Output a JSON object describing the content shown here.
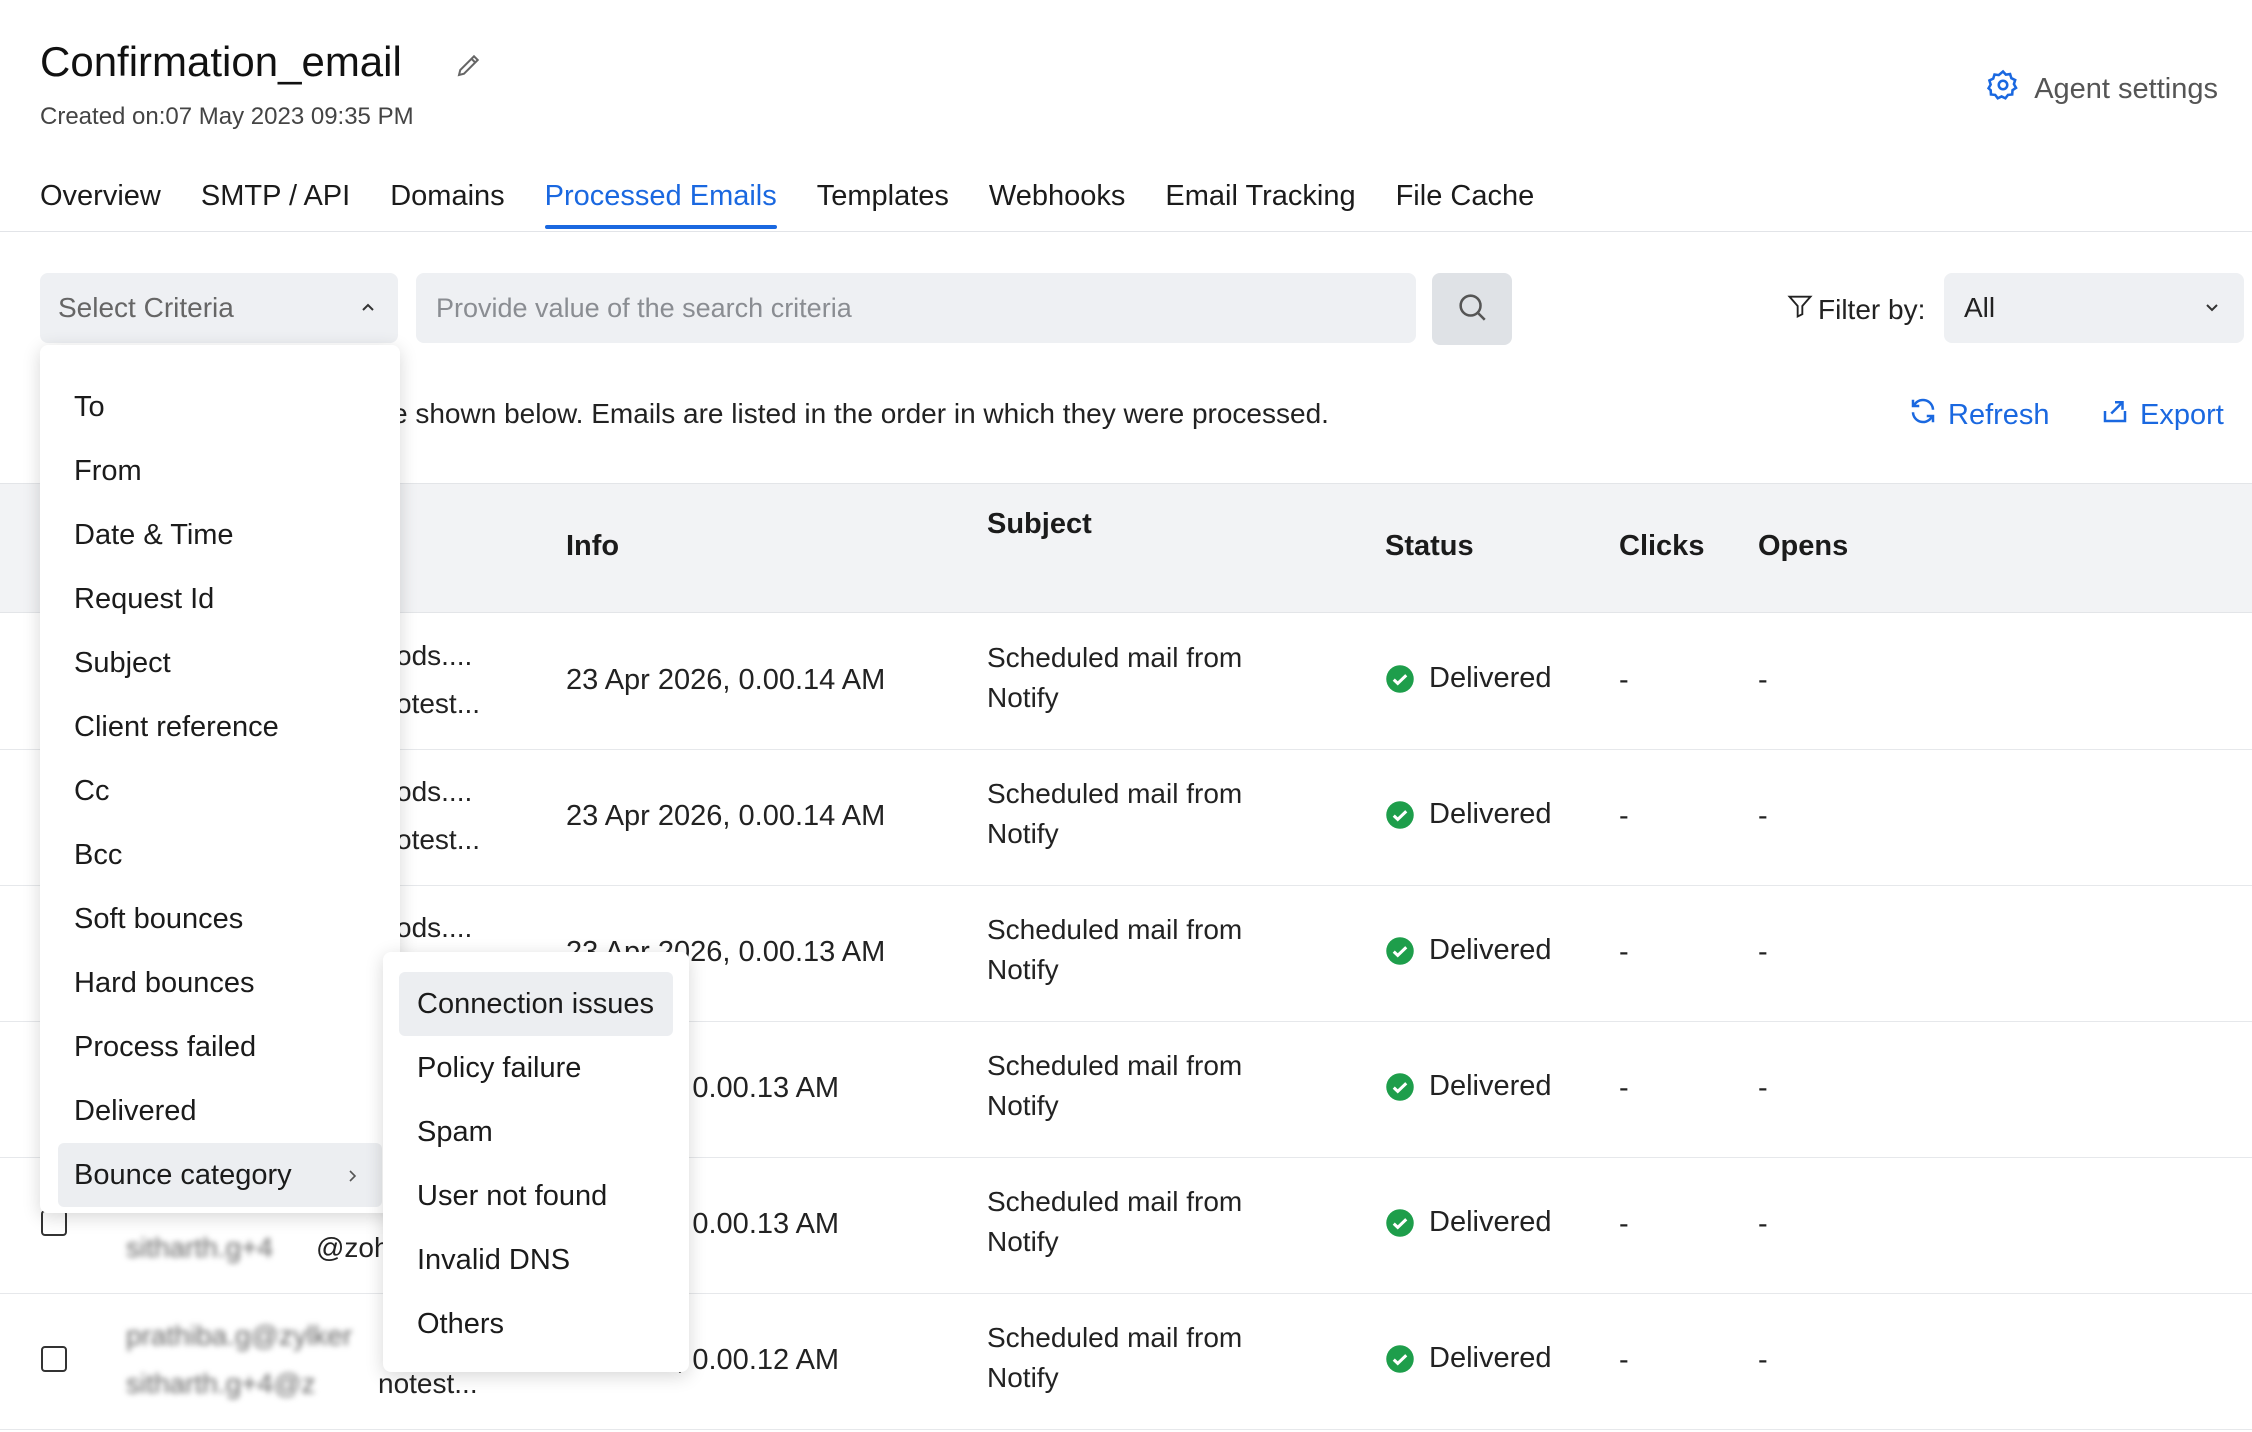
{
  "header": {
    "title": "Confirmation_email",
    "created": "Created on:07 May 2023 09:35 PM",
    "agent_settings": "Agent settings"
  },
  "tabs": [
    {
      "label": "Overview"
    },
    {
      "label": "SMTP / API"
    },
    {
      "label": "Domains"
    },
    {
      "label": "Processed Emails",
      "active": true
    },
    {
      "label": "Templates"
    },
    {
      "label": "Webhooks"
    },
    {
      "label": "Email Tracking"
    },
    {
      "label": "File Cache"
    }
  ],
  "search": {
    "criteria_label": "Select Criteria",
    "placeholder": "Provide value of the search criteria",
    "filter_label": "Filter by:",
    "filter_value": "All"
  },
  "info": {
    "text": "e shown below. Emails are listed in the order in which they were processed.",
    "refresh": "Refresh",
    "export": "Export"
  },
  "table": {
    "columns": [
      "Info",
      "Subject",
      "Status",
      "Clicks",
      "Opens"
    ],
    "rows": [
      {
        "from_top": "ods....",
        "from_bottom": "otest...",
        "info": "23 Apr 2026, 0.00.14 AM",
        "subject_1": "Scheduled mail from",
        "subject_2": "Notify",
        "status": "Delivered",
        "clicks": "-",
        "opens": "-"
      },
      {
        "from_top": "ods....",
        "from_bottom": "otest...",
        "info": "23 Apr 2026, 0.00.14 AM",
        "subject_1": "Scheduled mail from",
        "subject_2": "Notify",
        "status": "Delivered",
        "clicks": "-",
        "opens": "-"
      },
      {
        "from_top": "ods....",
        "from_bottom": "",
        "info": "23 Apr 2026, 0.00.13 AM",
        "subject_1": "Scheduled mail from",
        "subject_2": "Notify",
        "status": "Delivered",
        "clicks": "-",
        "opens": "-"
      },
      {
        "from_top": "",
        "from_bottom": "",
        "info": "26, 0.00.13 AM",
        "subject_1": "Scheduled mail from",
        "subject_2": "Notify",
        "status": "Delivered",
        "clicks": "-",
        "opens": "-"
      },
      {
        "from_top": "",
        "from_bottom": "@zoh",
        "info": "26, 0.00.13 AM",
        "subject_1": "Scheduled mail from",
        "subject_2": "Notify",
        "status": "Delivered",
        "clicks": "-",
        "opens": "-"
      },
      {
        "from_top": "prathiba.g@zylker",
        "from_bottom": "notest...",
        "info": "26, 0.00.12 AM",
        "subject_1": "Scheduled mail from",
        "subject_2": "Notify",
        "status": "Delivered",
        "clicks": "-",
        "opens": "-"
      }
    ]
  },
  "criteria_menu": {
    "items": [
      "To",
      "From",
      "Date & Time",
      "Request Id",
      "Subject",
      "Client reference",
      "Cc",
      "Bcc",
      "Soft bounces",
      "Hard bounces",
      "Process failed",
      "Delivered",
      "Bounce category"
    ]
  },
  "bounce_submenu": {
    "items": [
      "Connection issues",
      "Policy failure",
      "Spam",
      "User not found",
      "Invalid DNS",
      "Others"
    ]
  },
  "colors": {
    "accent": "#1a68e0",
    "success": "#1e9e4b"
  }
}
